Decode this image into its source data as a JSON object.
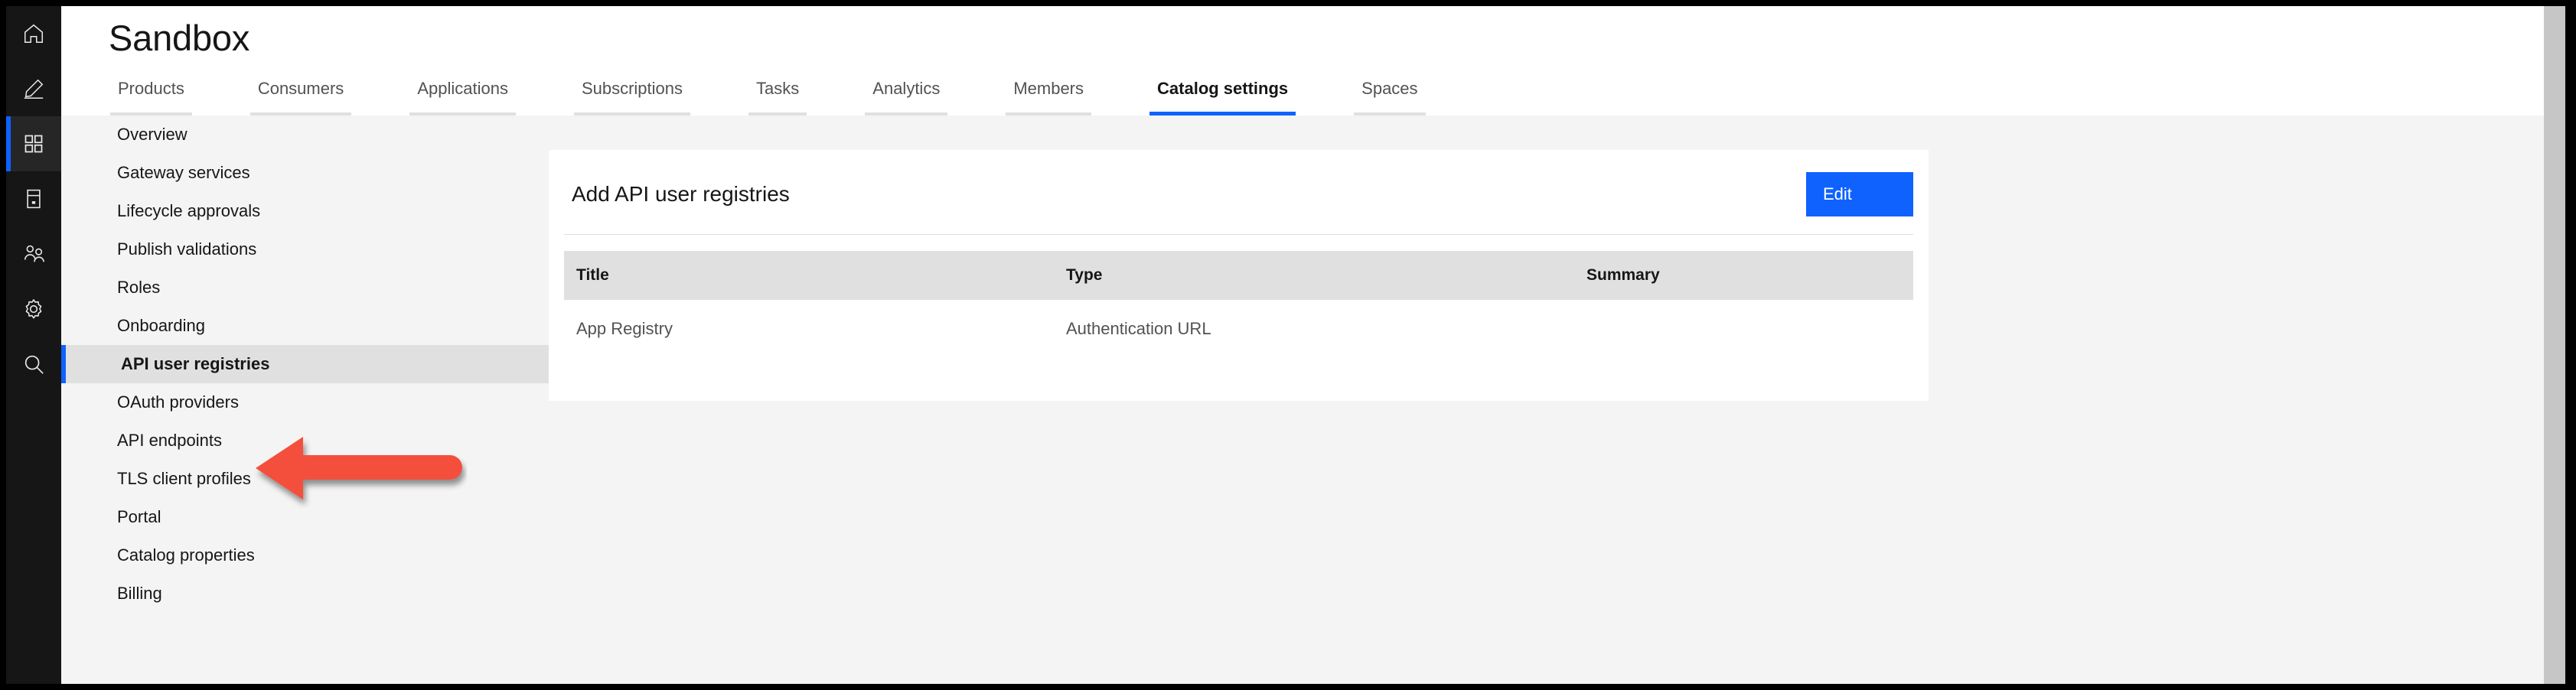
{
  "colors": {
    "accent_blue": "#0f62fe",
    "rail_bg": "#161616",
    "rail_active_bg": "#262626",
    "page_bg": "#f4f4f4",
    "card_bg": "#ffffff",
    "table_header_bg": "#e0e0e0",
    "nav_active_bg": "#e0e0e0",
    "annotation_red": "#f4503c"
  },
  "rail": {
    "items": [
      {
        "icon": "home-icon",
        "active": false
      },
      {
        "icon": "pencil-icon",
        "active": false
      },
      {
        "icon": "grid-icon",
        "active": true
      },
      {
        "icon": "server-icon",
        "active": false
      },
      {
        "icon": "users-icon",
        "active": false
      },
      {
        "icon": "gear-icon",
        "active": false
      },
      {
        "icon": "search-icon",
        "active": false
      }
    ]
  },
  "header": {
    "title": "Sandbox",
    "tabs": [
      {
        "label": "Products",
        "active": false
      },
      {
        "label": "Consumers",
        "active": false
      },
      {
        "label": "Applications",
        "active": false
      },
      {
        "label": "Subscriptions",
        "active": false
      },
      {
        "label": "Tasks",
        "active": false
      },
      {
        "label": "Analytics",
        "active": false
      },
      {
        "label": "Members",
        "active": false
      },
      {
        "label": "Catalog settings",
        "active": true
      },
      {
        "label": "Spaces",
        "active": false
      }
    ]
  },
  "subnav": {
    "items": [
      {
        "label": "Overview",
        "active": false
      },
      {
        "label": "Gateway services",
        "active": false
      },
      {
        "label": "Lifecycle approvals",
        "active": false
      },
      {
        "label": "Publish validations",
        "active": false
      },
      {
        "label": "Roles",
        "active": false
      },
      {
        "label": "Onboarding",
        "active": false
      },
      {
        "label": "API user registries",
        "active": true
      },
      {
        "label": "OAuth providers",
        "active": false
      },
      {
        "label": "API endpoints",
        "active": false
      },
      {
        "label": "TLS client profiles",
        "active": false
      },
      {
        "label": "Portal",
        "active": false
      },
      {
        "label": "Catalog properties",
        "active": false
      },
      {
        "label": "Billing",
        "active": false
      }
    ]
  },
  "card": {
    "title": "Add API user registries",
    "edit_label": "Edit",
    "table": {
      "columns": [
        "Title",
        "Type",
        "Summary"
      ],
      "rows": [
        {
          "title": "App Registry",
          "type": "Authentication URL",
          "summary": ""
        }
      ]
    }
  },
  "annotation": {
    "kind": "arrow-left",
    "points_at": "OAuth providers"
  }
}
